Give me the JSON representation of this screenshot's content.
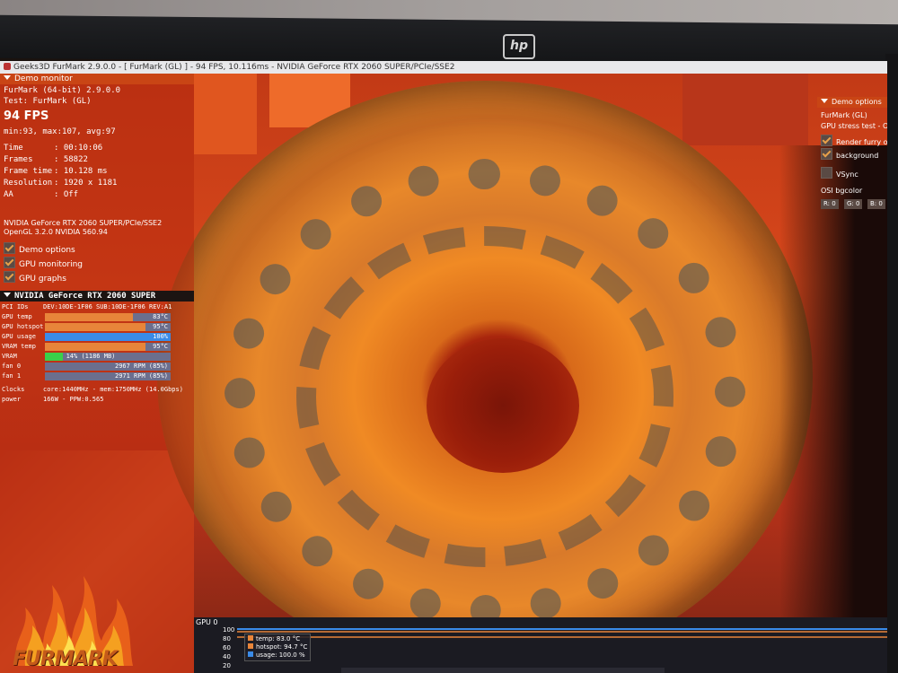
{
  "window": {
    "title": "Geeks3D FurMark 2.9.0.0 - [ FurMark (GL) ] - 94 FPS, 10.116ms - NVIDIA GeForce RTX 2060 SUPER/PCIe/SSE2",
    "brand": "hp"
  },
  "left_panel": {
    "header": "Demo monitor",
    "app_name": "FurMark (64-bit) 2.9.0.0",
    "test": "Test: FurMark (GL)",
    "fps": "94 FPS",
    "fps_stats": "min:93, max:107, avg:97",
    "stats": [
      {
        "k": "Time",
        "v": ": 00:10:06"
      },
      {
        "k": "Frames",
        "v": ": 58822"
      },
      {
        "k": "Frame time",
        "v": ": 10.128 ms"
      },
      {
        "k": "Resolution",
        "v": ": 1920 x 1181"
      },
      {
        "k": "AA",
        "v": ": Off"
      }
    ],
    "gpu_line1": "NVIDIA GeForce RTX 2060 SUPER/PCIe/SSE2",
    "gpu_line2": "OpenGL 3.2.0 NVIDIA 560.94",
    "options": [
      {
        "label": "Demo options",
        "checked": true
      },
      {
        "label": "GPU monitoring",
        "checked": true
      },
      {
        "label": "GPU graphs",
        "checked": true
      }
    ]
  },
  "gpu_section": {
    "header": "NVIDIA GeForce RTX 2060 SUPER",
    "pci_label": "PCI IDs",
    "pci_value": "DEV:10DE-1F06 SUB:10DE-1F06 REV:A1",
    "bars": [
      {
        "label": "GPU temp",
        "text": "83°C",
        "fraction": 0.7,
        "color": "#e8853a"
      },
      {
        "label": "GPU hotspot",
        "text": "95°C",
        "fraction": 0.8,
        "color": "#e8853a"
      },
      {
        "label": "GPU usage",
        "text": "100%",
        "fraction": 1.0,
        "color": "#3a8be8"
      },
      {
        "label": "VRAM temp",
        "text": "95°C",
        "fraction": 0.8,
        "color": "#e8853a"
      },
      {
        "label": "VRAM",
        "text": "14% (1186 MB)",
        "fraction": 0.14,
        "color": "#3ad04a"
      },
      {
        "label": "fan 0",
        "text": "2967 RPM (85%)",
        "fraction": 0.85,
        "color": "#6b6f8e"
      },
      {
        "label": "fan 1",
        "text": "2971 RPM (85%)",
        "fraction": 0.85,
        "color": "#6b6f8e"
      }
    ],
    "clocks_label": "Clocks",
    "clocks_value": "core:1440MHz - mem:1750MHz (14.0Gbps)",
    "power_label": "power",
    "power_value": "166W - PPW:0.565"
  },
  "logo_text": "FURMARK",
  "right_panel": {
    "header": "Demo options",
    "line1": "FurMark (GL)",
    "line2": "GPU stress test - OpenGl",
    "render_label": "Render furry object",
    "render_checked": true,
    "bg_label": "background",
    "bg_checked": true,
    "vsync_label": "VSync",
    "vsync_checked": false,
    "osi_label": "OSI bgcolor",
    "r": "R: 0",
    "g": "G: 0",
    "b": "B: 0"
  },
  "graph": {
    "label": "GPU 0",
    "y_ticks": [
      "100",
      "80",
      "60",
      "40",
      "20"
    ],
    "legend": [
      {
        "text": "temp: 83.0 °C",
        "color": "#e8853a"
      },
      {
        "text": "hotspot: 94.7 °C",
        "color": "#e8853a"
      },
      {
        "text": "usage: 100.0 %",
        "color": "#3a8be8"
      }
    ]
  }
}
